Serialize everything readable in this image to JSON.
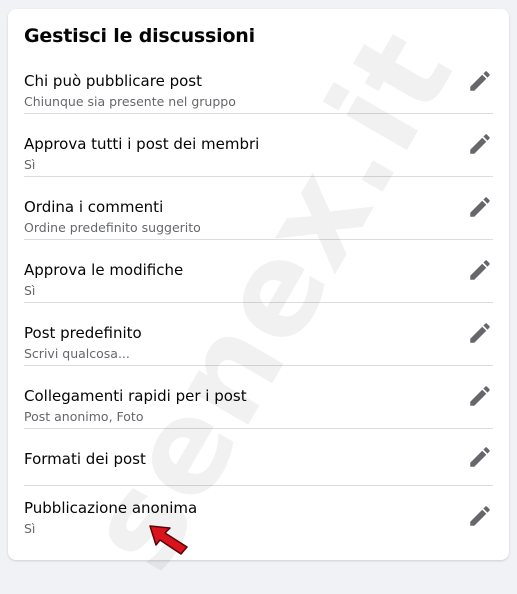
{
  "panel": {
    "title": "Gestisci le discussioni",
    "settings": [
      {
        "label": "Chi può pubblicare post",
        "value": "Chiunque sia presente nel gruppo"
      },
      {
        "label": "Approva tutti i post dei membri",
        "value": "Sì"
      },
      {
        "label": "Ordina i commenti",
        "value": "Ordine predefinito suggerito"
      },
      {
        "label": "Approva le modifiche",
        "value": "Sì"
      },
      {
        "label": "Post predefinito",
        "value": "Scrivi qualcosa..."
      },
      {
        "label": "Collegamenti rapidi per i post",
        "value": "Post anonimo, Foto"
      },
      {
        "label": "Formati dei post"
      },
      {
        "label": "Pubblicazione anonima",
        "value": "Sì"
      }
    ]
  },
  "watermark": "senex.it",
  "icons": {
    "edit": "pencil-icon",
    "annotation": "red-arrow-icon"
  },
  "colors": {
    "icon": "#65676b",
    "arrow": "#d9141e"
  }
}
